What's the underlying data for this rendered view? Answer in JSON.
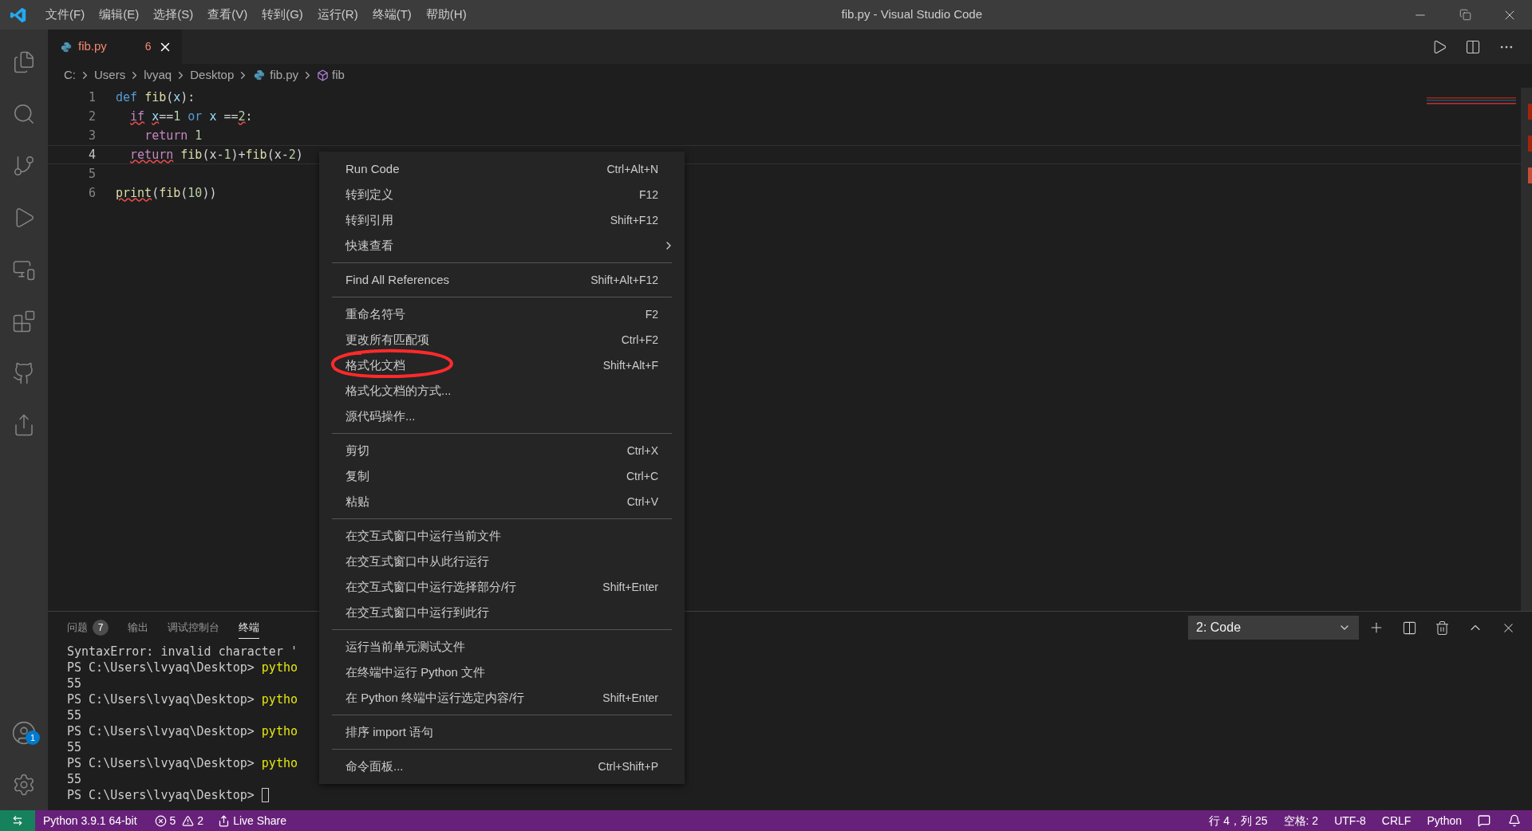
{
  "window": {
    "title": "fib.py - Visual Studio Code",
    "menu": [
      "文件(F)",
      "编辑(E)",
      "选择(S)",
      "查看(V)",
      "转到(G)",
      "运行(R)",
      "终端(T)",
      "帮助(H)"
    ]
  },
  "activity_bar": {
    "account_badge": "1"
  },
  "tab": {
    "label": "fib.py",
    "problems": "6"
  },
  "breadcrumb": [
    "C:",
    "Users",
    "lvyaq",
    "Desktop",
    "fib.py",
    "fib"
  ],
  "editor": {
    "lines": [
      {
        "number": "1",
        "current": false,
        "tokens": [
          {
            "text": "def",
            "kind": "keyword"
          },
          {
            "text": " fib",
            "kind": "function"
          },
          {
            "text": "("
          },
          {
            "text": "x",
            "kind": "param"
          },
          {
            "text": "):"
          }
        ]
      },
      {
        "number": "2",
        "current": false,
        "tokens": [
          {
            "text": "  if",
            "kind": "control",
            "squiggle": true
          },
          {
            "text": " x",
            "kind": "param",
            "squiggle": true
          },
          {
            "text": "=="
          },
          {
            "text": "1",
            "kind": "number"
          },
          {
            "text": " or",
            "kind": "keyword"
          },
          {
            "text": " x",
            "kind": "param"
          },
          {
            "text": " =="
          },
          {
            "text": "2",
            "kind": "number",
            "squiggle": true
          },
          {
            "text": ":"
          }
        ]
      },
      {
        "number": "3",
        "current": false,
        "tokens": [
          {
            "text": "    return",
            "kind": "control"
          },
          {
            "text": " 1",
            "kind": "number"
          }
        ]
      },
      {
        "number": "4",
        "current": true,
        "tokens": [
          {
            "text": "  return",
            "kind": "control",
            "squiggle": true
          },
          {
            "text": " fib",
            "kind": "function"
          },
          {
            "text": "(x-"
          },
          {
            "text": "1",
            "kind": "number"
          },
          {
            "text": ")+"
          },
          {
            "text": "fib",
            "kind": "function"
          },
          {
            "text": "(x-"
          },
          {
            "text": "2",
            "kind": "number"
          },
          {
            "text": ")"
          }
        ]
      },
      {
        "number": "5",
        "current": false
      },
      {
        "number": "6",
        "current": false,
        "tokens": [
          {
            "text": "print",
            "kind": "function",
            "squiggle": true
          },
          {
            "text": "("
          },
          {
            "text": "fib",
            "kind": "function"
          },
          {
            "text": "("
          },
          {
            "text": "10",
            "kind": "number"
          },
          {
            "text": "))"
          }
        ]
      }
    ]
  },
  "context_menu": [
    {
      "kind": "item",
      "label": "Run Code",
      "shortcut": "Ctrl+Alt+N"
    },
    {
      "kind": "item",
      "label": "转到定义",
      "shortcut": "F12"
    },
    {
      "kind": "item",
      "label": "转到引用",
      "shortcut": "Shift+F12"
    },
    {
      "kind": "submenu",
      "label": "快速查看"
    },
    {
      "kind": "separator"
    },
    {
      "kind": "item",
      "label": "Find All References",
      "shortcut": "Shift+Alt+F12"
    },
    {
      "kind": "separator"
    },
    {
      "kind": "item",
      "label": "重命名符号",
      "shortcut": "F2"
    },
    {
      "kind": "item",
      "label": "更改所有匹配项",
      "shortcut": "Ctrl+F2"
    },
    {
      "kind": "item",
      "label": "格式化文档",
      "shortcut": "Shift+Alt+F",
      "circled": true
    },
    {
      "kind": "item",
      "label": "格式化文档的方式..."
    },
    {
      "kind": "item",
      "label": "源代码操作..."
    },
    {
      "kind": "separator"
    },
    {
      "kind": "item",
      "label": "剪切",
      "shortcut": "Ctrl+X"
    },
    {
      "kind": "item",
      "label": "复制",
      "shortcut": "Ctrl+C"
    },
    {
      "kind": "item",
      "label": "粘贴",
      "shortcut": "Ctrl+V"
    },
    {
      "kind": "separator"
    },
    {
      "kind": "item",
      "label": "在交互式窗口中运行当前文件"
    },
    {
      "kind": "item",
      "label": "在交互式窗口中从此行运行"
    },
    {
      "kind": "item",
      "label": "在交互式窗口中运行选择部分/行",
      "shortcut": "Shift+Enter"
    },
    {
      "kind": "item",
      "label": "在交互式窗口中运行到此行"
    },
    {
      "kind": "separator"
    },
    {
      "kind": "item",
      "label": "运行当前单元测试文件"
    },
    {
      "kind": "item",
      "label": "在终端中运行 Python 文件"
    },
    {
      "kind": "item",
      "label": "在 Python 终端中运行选定内容/行",
      "shortcut": "Shift+Enter"
    },
    {
      "kind": "separator"
    },
    {
      "kind": "item",
      "label": "排序 import 语句"
    },
    {
      "kind": "separator"
    },
    {
      "kind": "item",
      "label": "命令面板...",
      "shortcut": "Ctrl+Shift+P"
    }
  ],
  "panel": {
    "tabs": [
      {
        "label": "问题",
        "count": "7",
        "selected": false
      },
      {
        "label": "输出",
        "selected": false
      },
      {
        "label": "调试控制台",
        "selected": false
      },
      {
        "label": "终端",
        "selected": true
      }
    ],
    "terminal_select": "2: Code",
    "terminal_lines": [
      {
        "prompt": "SyntaxError: invalid character '"
      },
      {
        "prompt": "PS C:\\Users\\lvyaq\\Desktop> ",
        "command": "pytho"
      },
      {
        "prompt": "55"
      },
      {
        "prompt": "PS C:\\Users\\lvyaq\\Desktop> ",
        "command": "pytho"
      },
      {
        "prompt": "55"
      },
      {
        "prompt": "PS C:\\Users\\lvyaq\\Desktop> ",
        "command": "pytho"
      },
      {
        "prompt": "55"
      },
      {
        "prompt": "PS C:\\Users\\lvyaq\\Desktop> ",
        "command": "pytho"
      },
      {
        "prompt": "55"
      },
      {
        "prompt": "PS C:\\Users\\lvyaq\\Desktop> ",
        "cursor": true
      }
    ]
  },
  "status_bar": {
    "interpreter": "Python 3.9.1 64-bit",
    "errors": "5",
    "warnings": "2",
    "live_share": "Live Share",
    "position": "行 4，列 25",
    "indent": "空格: 2",
    "encoding": "UTF-8",
    "eol": "CRLF",
    "language": "Python"
  }
}
